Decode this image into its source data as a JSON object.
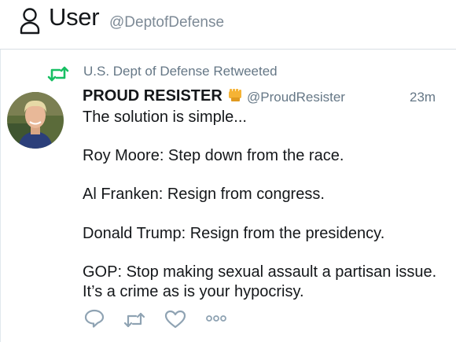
{
  "header": {
    "title": "User",
    "handle": "@DeptofDefense",
    "icon": "user-icon"
  },
  "tweet": {
    "retweet_text": "U.S. Dept of Defense Retweeted",
    "author_name": "PROUD RESISTER",
    "author_badge_icon": "raised-fist-icon",
    "author_handle": "@ProudResister",
    "time": "23m",
    "lines": [
      "The solution is simple...",
      "Roy Moore: Step down from the race.",
      "Al Franken: Resign from congress.",
      "Donald Trump: Resign from the presidency.",
      "GOP: Stop making sexual assault a partisan issue.",
      "It’s a crime as is your hypocrisy."
    ],
    "actions": [
      "reply-icon",
      "retweet-icon",
      "like-icon",
      "more-icon"
    ]
  },
  "colors": {
    "retweet_green": "#17bf63",
    "muted": "#657786",
    "action_gray": "#8fa3b3"
  }
}
